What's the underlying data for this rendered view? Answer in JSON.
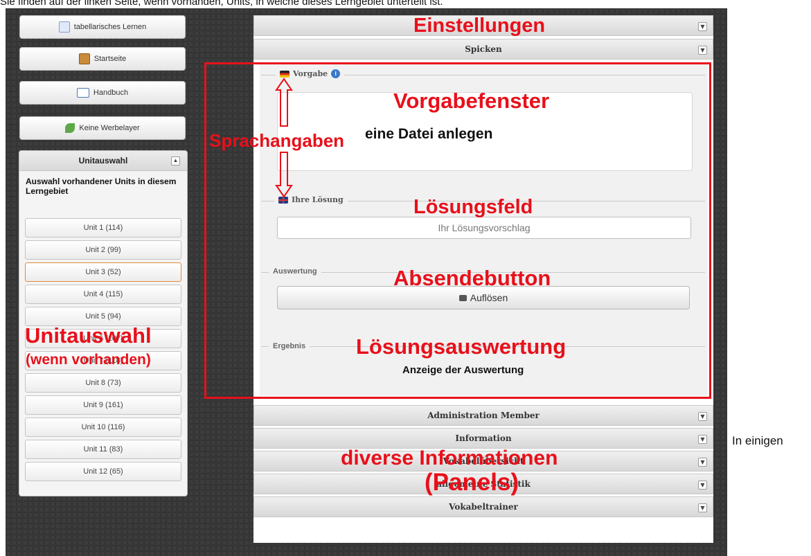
{
  "page": {
    "top_text": "Sie finden auf der linken Seite, wenn vorhanden, Units, in welche dieses Lerngebiet unterteilt ist.",
    "right_text": "In einigen"
  },
  "nav": {
    "buttons": [
      {
        "label": "tabellarisches Lernen",
        "icon": "table-icon"
      },
      {
        "label": "Startseite",
        "icon": "book-icon"
      },
      {
        "label": "Handbuch",
        "icon": "open-book-icon"
      },
      {
        "label": "Keine Werbelayer",
        "icon": "leaf-icon"
      }
    ]
  },
  "units": {
    "title": "Unitauswahl",
    "intro": "Auswahl vorhandener Units in diesem Lerngebiet",
    "items": [
      {
        "label": "Unit 1   (114)"
      },
      {
        "label": "Unit 2   (99)"
      },
      {
        "label": "Unit 3   (52)"
      },
      {
        "label": "Unit 4   (115)"
      },
      {
        "label": "Unit 5   (94)"
      },
      {
        "label": "Unit 6   (107)"
      },
      {
        "label": "Unit 7   (118)"
      },
      {
        "label": "Unit 8   (73)"
      },
      {
        "label": "Unit 9   (161)"
      },
      {
        "label": "Unit 10   (116)"
      },
      {
        "label": "Unit 11   (83)"
      },
      {
        "label": "Unit 12   (65)"
      }
    ],
    "selected_index": 2
  },
  "main": {
    "panel_settings": "Einstellungen",
    "panel_spicken": "Spicken",
    "vorgabe_legend": "Vorgabe",
    "vorgabe_text": "eine Datei anlegen",
    "solution_legend": "Ihre Lösung",
    "solution_placeholder": "Ihr Lösungsvorschlag",
    "evaluation_legend": "Auswertung",
    "submit_label": "Auflösen",
    "result_legend": "Ergebnis",
    "result_text": "Anzeige der Auswertung",
    "panels": [
      "Administration Member",
      "Information",
      "Vokabelübersicht",
      "allgemeine Statistik",
      "Vokabeltrainer"
    ]
  },
  "annotations": {
    "vorgabefenster": "Vorgabefenster",
    "sprachangaben": "Sprachangaben",
    "loesungsfeld": "Lösungsfeld",
    "absendebutton": "Absendebutton",
    "loesungsauswertung": "Lösungsauswertung",
    "unitauswahl": "Unitauswahl",
    "unitauswahl_sub": "(wenn vorhanden)",
    "diverse": "diverse Informationen",
    "panels_note": "(Panels)",
    "color": "#e8101a"
  }
}
